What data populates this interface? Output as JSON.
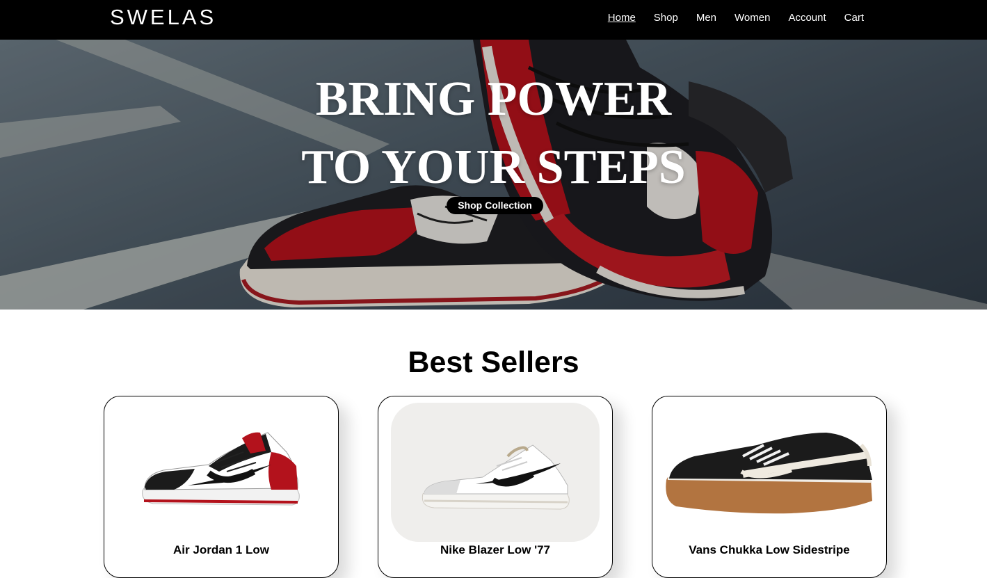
{
  "brand": {
    "logo": "SWELAS"
  },
  "nav": {
    "items": [
      {
        "label": "Home",
        "active": true
      },
      {
        "label": "Shop"
      },
      {
        "label": "Men"
      },
      {
        "label": "Women"
      },
      {
        "label": "Account"
      },
      {
        "label": "Cart"
      }
    ]
  },
  "hero": {
    "title_line1": "BRING POWER",
    "title_line2": "TO YOUR STEPS",
    "button_label": "Shop Collection"
  },
  "best_sellers": {
    "title": "Best Sellers",
    "products": [
      {
        "name": "Air Jordan 1 Low",
        "icon": "sneaker-jordan-image"
      },
      {
        "name": "Nike Blazer Low '77",
        "icon": "sneaker-blazer-image"
      },
      {
        "name": "Vans Chukka Low Sidestripe",
        "icon": "sneaker-vans-image"
      }
    ]
  },
  "colors": {
    "nav_bg": "#000000",
    "accent_red": "#b3121c",
    "text": "#000000",
    "card_border": "#000000"
  }
}
